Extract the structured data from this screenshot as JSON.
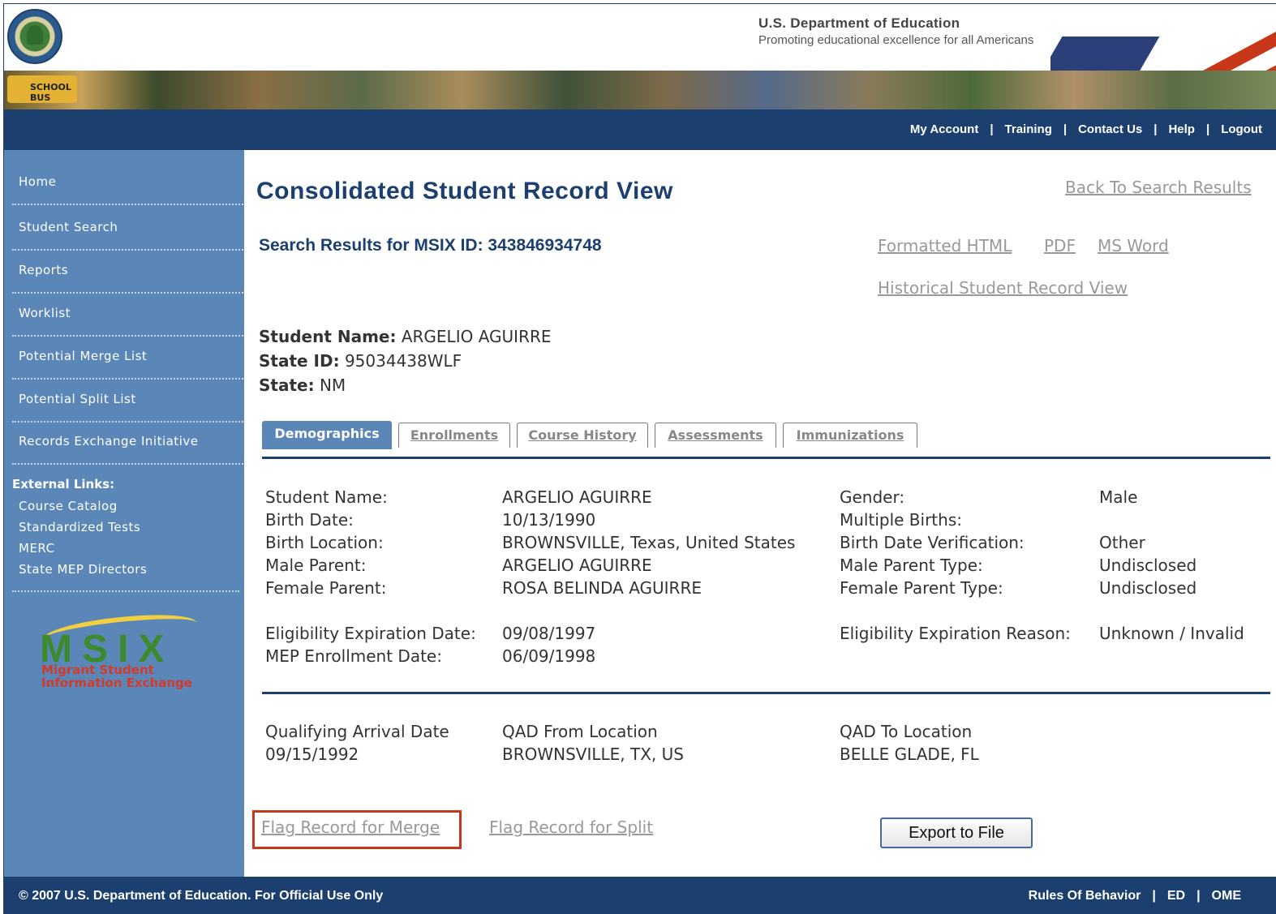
{
  "header": {
    "dept_title": "U.S. Department of Education",
    "dept_tagline": "Promoting educational excellence for all Americans",
    "bus_label": "SCHOOL BUS",
    "nav": [
      "My Account",
      "Training",
      "Contact Us",
      "Help",
      "Logout"
    ]
  },
  "sidebar": {
    "items": [
      "Home",
      "Student Search",
      "Reports",
      "Worklist",
      "Potential Merge List",
      "Potential Split List",
      "Records Exchange Initiative"
    ],
    "external_title": "External Links:",
    "external_links": [
      "Course Catalog",
      "Standardized Tests",
      "MERC",
      "State MEP Directors"
    ],
    "logo_letters": "MSIX",
    "logo_line1": "Migrant Student",
    "logo_line2": "Information Exchange"
  },
  "main": {
    "title": "Consolidated Student Record View",
    "back_link": "Back To Search Results",
    "search_results": "Search Results for MSIX ID: 343846934748",
    "formats": [
      "Formatted HTML",
      "PDF",
      "MS Word"
    ],
    "historical": "Historical Student Record View",
    "student_name_label": "Student Name:",
    "student_name": "ARGELIO AGUIRRE",
    "state_id_label": "State ID:",
    "state_id": "95034438WLF",
    "state_label": "State:",
    "state": "NM",
    "tabs": [
      "Demographics",
      "Enrollments",
      "Course History",
      "Assessments",
      "Immunizations"
    ],
    "demographics": {
      "left": [
        {
          "label": "Student Name:",
          "value": "ARGELIO AGUIRRE"
        },
        {
          "label": "Birth Date:",
          "value": "10/13/1990"
        },
        {
          "label": "Birth Location:",
          "value": "BROWNSVILLE, Texas, United States"
        },
        {
          "label": "Male Parent:",
          "value": "ARGELIO AGUIRRE"
        },
        {
          "label": "Female Parent:",
          "value": "ROSA BELINDA AGUIRRE"
        },
        {
          "label": "Eligibility Expiration Date:",
          "value": "09/08/1997"
        },
        {
          "label": "MEP Enrollment Date:",
          "value": "06/09/1998"
        }
      ],
      "right": [
        {
          "label": "Gender:",
          "value": "Male"
        },
        {
          "label": "Multiple Births:",
          "value": ""
        },
        {
          "label": "Birth Date Verification:",
          "value": "Other"
        },
        {
          "label": "Male Parent Type:",
          "value": "Undisclosed"
        },
        {
          "label": "Female Parent Type:",
          "value": "Undisclosed"
        },
        {
          "label": "Eligibility Expiration Reason:",
          "value": "Unknown / Invalid"
        }
      ]
    },
    "qad": [
      {
        "label": "Qualifying Arrival Date",
        "value": "09/15/1992"
      },
      {
        "label": "QAD From Location",
        "value": "BROWNSVILLE, TX, US"
      },
      {
        "label": "QAD To Location",
        "value": "BELLE GLADE, FL"
      }
    ],
    "flag_merge": "Flag Record for Merge",
    "flag_split": "Flag Record for Split",
    "export_button": "Export to File"
  },
  "footer": {
    "copyright": "© 2007 U.S. Department of Education. For Official Use Only",
    "links": [
      "Rules Of Behavior",
      "ED",
      "OME"
    ]
  },
  "colors": {
    "navy": "#1b3f6e",
    "sidebar_blue": "#5b86b8",
    "link_gray": "#999999",
    "highlight_red": "#c8371a"
  }
}
